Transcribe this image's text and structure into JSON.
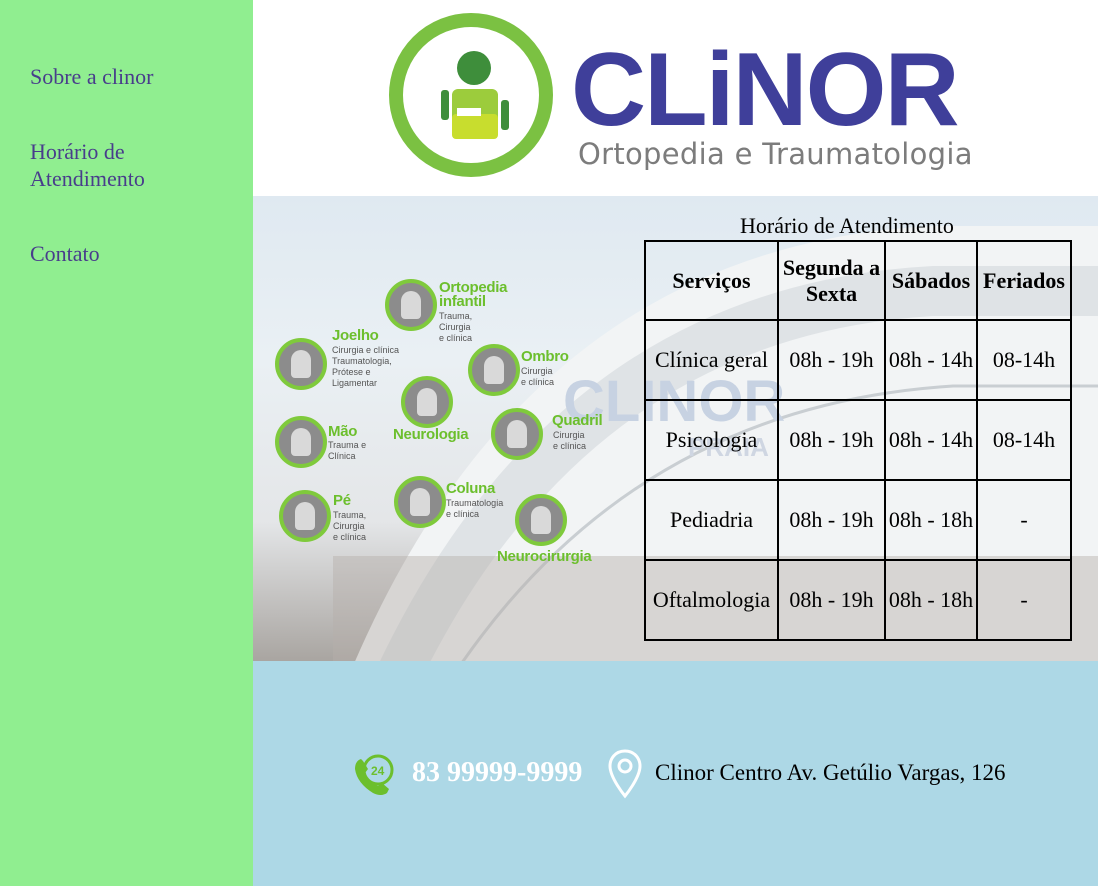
{
  "sidebar": {
    "items": [
      {
        "label": "Sobre a clinor"
      },
      {
        "label": "Horário de Atendimento"
      },
      {
        "label": "Contato"
      }
    ]
  },
  "logo": {
    "brand": "CLiNOR",
    "tagline": "Ortopedia e Traumatologia",
    "colors": {
      "green": "#7bc142",
      "blue": "#3f3f9a",
      "gray": "#7c7c7c"
    }
  },
  "hero": {
    "watermark": "CLINOR",
    "watermark_sub": "PRAIA",
    "services": [
      {
        "title": "Ortopedia infantil",
        "detail": "Trauma,\nCirurgia\ne clínica"
      },
      {
        "title": "Joelho",
        "detail": "Cirurgia e clínica\nTraumatologia,\nPrótese e\nLigamentar"
      },
      {
        "title": "Ombro",
        "detail": "Cirurgia\ne clínica"
      },
      {
        "title": "Neurologia",
        "detail": ""
      },
      {
        "title": "Mão",
        "detail": "Trauma e\nClínica"
      },
      {
        "title": "Quadril",
        "detail": "Cirurgia\ne clínica"
      },
      {
        "title": "Coluna",
        "detail": "Traumatologia\ne clínica"
      },
      {
        "title": "Pé",
        "detail": "Trauma,\nCirurgia\ne clínica"
      },
      {
        "title": "Neurocirurgia",
        "detail": ""
      }
    ]
  },
  "schedule": {
    "title": "Horário de Atendimento",
    "headers": [
      "Serviços",
      "Segunda a Sexta",
      "Sábados",
      "Feriados"
    ],
    "rows": [
      [
        "Clínica geral",
        "08h - 19h",
        "08h - 14h",
        "08-14h"
      ],
      [
        "Psicologia",
        "08h - 19h",
        "08h - 14h",
        "08-14h"
      ],
      [
        "Pediadria",
        "08h - 19h",
        "08h - 18h",
        "-"
      ],
      [
        "Oftalmologia",
        "08h - 19h",
        "08h - 18h",
        "-"
      ]
    ]
  },
  "footer": {
    "phone_badge": "24",
    "phone": "83 99999-9999",
    "address": "Clinor Centro Av. Getúlio Vargas, 126",
    "icons": [
      "phone-24h-icon",
      "location-pin-icon"
    ]
  }
}
